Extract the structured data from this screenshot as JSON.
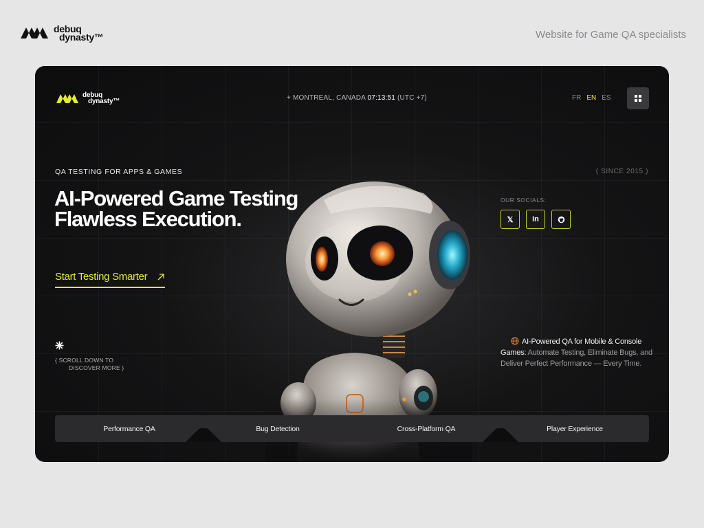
{
  "outer": {
    "brand_line1": "debuq",
    "brand_line2": "dynasty™",
    "tagline": "Website for Game QA specialists"
  },
  "header": {
    "brand_line1": "debuq",
    "brand_line2": "dynasty™",
    "location_prefix": "+ MONTREAL, CANADA ",
    "time": "07:13:51",
    "timezone": " (UTC +7)",
    "languages": [
      "FR",
      "EN",
      "ES"
    ],
    "active_language": "EN",
    "menu_icon": "grid-icon"
  },
  "hero": {
    "eyebrow": "QA TESTING FOR APPS & GAMES",
    "since": "( SINCE 2015 )",
    "headline_line1": "AI-Powered Game Testing",
    "headline_line2": "Flawless Execution.",
    "cta_label": "Start Testing Smarter",
    "scroll_line1": "{ SCROLL DOWN TO",
    "scroll_line2": "DISCOVER MORE }"
  },
  "socials": {
    "label": "OUR SOCIALS:",
    "items": [
      {
        "name": "x",
        "glyph": "𝕏"
      },
      {
        "name": "linkedin",
        "glyph": "in"
      },
      {
        "name": "github",
        "glyph": ""
      }
    ]
  },
  "description": {
    "highlight": "AI-Powered QA for Mobile & Console Games:",
    "rest": " Automate Testing, Eliminate Bugs, and Deliver Perfect Performance — Every Time."
  },
  "tabs": [
    "Performance QA",
    "Bug Detection",
    "Cross-Platform QA",
    "Player Experience"
  ],
  "colors": {
    "accent": "#e4ec2c",
    "card_bg": "#0d0d0e",
    "page_bg": "#e6e6e7"
  }
}
